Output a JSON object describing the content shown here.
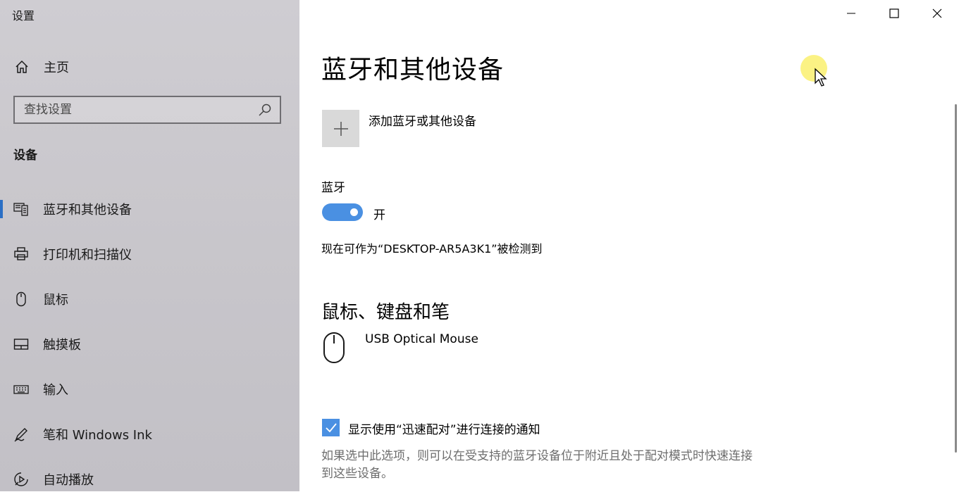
{
  "window": {
    "title": "设置",
    "controls": {
      "minimize": "minimize-icon",
      "maximize": "maximize-icon",
      "close": "close-icon"
    }
  },
  "sidebar": {
    "home_label": "主页",
    "search_placeholder": "查找设置",
    "section_title": "设备",
    "items": [
      {
        "label": "蓝牙和其他设备",
        "icon": "bluetooth-device-icon",
        "active": true
      },
      {
        "label": "打印机和扫描仪",
        "icon": "printer-icon",
        "active": false
      },
      {
        "label": "鼠标",
        "icon": "mouse-icon",
        "active": false
      },
      {
        "label": "触摸板",
        "icon": "touchpad-icon",
        "active": false
      },
      {
        "label": "输入",
        "icon": "keyboard-icon",
        "active": false
      },
      {
        "label": "笔和 Windows Ink",
        "icon": "pen-icon",
        "active": false
      },
      {
        "label": "自动播放",
        "icon": "autoplay-icon",
        "active": false
      }
    ]
  },
  "main": {
    "title": "蓝牙和其他设备",
    "add_device_label": "添加蓝牙或其他设备",
    "bluetooth_label": "蓝牙",
    "bluetooth_state": "开",
    "bluetooth_on": true,
    "detect_text": "现在可作为“DESKTOP-AR5A3K1”被检测到",
    "mouse_section_title": "鼠标、键盘和笔",
    "device_name": "USB Optical Mouse",
    "swift_pair_label": "显示使用“迅速配对”进行连接的通知",
    "swift_pair_checked": true,
    "swift_pair_desc": "如果选中此选项，则可以在受支持的蓝牙设备位于附近且处于配对模式时快速连接到这些设备。"
  },
  "colors": {
    "accent": "#4a90e2",
    "sidebar_bg": "#c8c6cb",
    "active_indicator": "#2b6fc5",
    "secondary_text": "#6d6d6d"
  }
}
